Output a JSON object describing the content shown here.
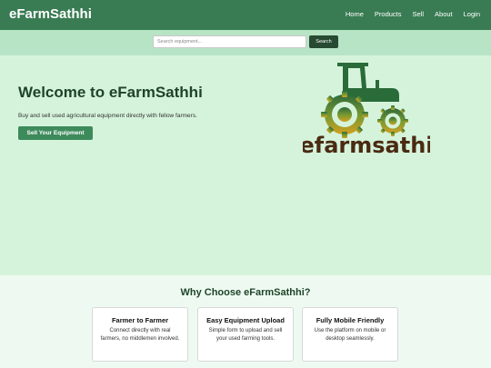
{
  "header": {
    "brand": "eFarmSathhi",
    "nav": [
      "Home",
      "Products",
      "Sell",
      "About",
      "Login"
    ]
  },
  "search": {
    "placeholder": "Search equipment...",
    "button": "Search"
  },
  "hero": {
    "title": "Welcome to eFarmSathhi",
    "subtitle": "Buy and sell used agricultural equipment directly with fellow farmers.",
    "cta": "Sell Your Equipment",
    "logo_text": "efarmsathi"
  },
  "why": {
    "title": "Why Choose eFarmSathhi?",
    "cards": [
      {
        "title": "Farmer to Farmer",
        "text": "Connect directly with real farmers, no middlemen involved."
      },
      {
        "title": "Easy Equipment Upload",
        "text": "Simple form to upload and sell your used farming tools."
      },
      {
        "title": "Fully Mobile Friendly",
        "text": "Use the platform on mobile or desktop seamlessly."
      }
    ]
  },
  "colors": {
    "header": "#397c53",
    "search_strip": "#b8e4c6",
    "hero_bg": "#d5f3db",
    "accent": "#3d8a5b",
    "logo_text": "#4a2a12"
  }
}
